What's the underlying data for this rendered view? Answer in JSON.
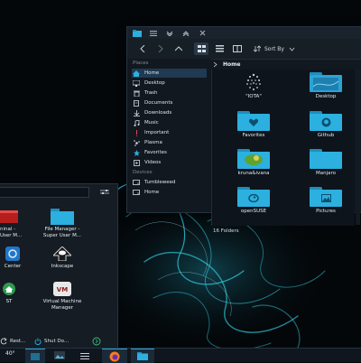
{
  "file_manager": {
    "sort_label": "Sort By",
    "breadcrumb": "Home",
    "sidebar": {
      "places_title": "Places",
      "devices_title": "Devices",
      "places": [
        {
          "label": "Home",
          "icon": "home-icon"
        },
        {
          "label": "Desktop",
          "icon": "desktop-icon"
        },
        {
          "label": "Trash",
          "icon": "trash-icon"
        },
        {
          "label": "Documents",
          "icon": "documents-icon"
        },
        {
          "label": "Downloads",
          "icon": "downloads-icon"
        },
        {
          "label": "Music",
          "icon": "music-icon"
        },
        {
          "label": "Important",
          "icon": "important-icon"
        },
        {
          "label": "Plasma",
          "icon": "plasma-icon"
        },
        {
          "label": "Favorites",
          "icon": "favorites-icon"
        },
        {
          "label": "Videos",
          "icon": "videos-icon"
        }
      ],
      "devices": [
        {
          "label": "Tumbleweed",
          "icon": "drive-icon"
        },
        {
          "label": "Home",
          "icon": "drive-icon"
        }
      ]
    },
    "files": [
      {
        "label": "\"IOTA\"",
        "icon": "iota-logo-icon"
      },
      {
        "label": "Desktop",
        "icon": "folder-desktop-icon"
      },
      {
        "label": "Favorites",
        "icon": "folder-favorites-icon"
      },
      {
        "label": "Github",
        "icon": "folder-github-icon"
      },
      {
        "label": "kruna&ivana",
        "icon": "folder-image-icon"
      },
      {
        "label": "Manjaro",
        "icon": "folder-icon"
      },
      {
        "label": "openSUSE",
        "icon": "folder-opensuse-icon"
      },
      {
        "label": "Pictures",
        "icon": "folder-pictures-icon"
      }
    ],
    "status": "16 Folders"
  },
  "launcher": {
    "apps": [
      {
        "line1": "ninal -",
        "line2": "User M...",
        "icon": "terminal-icon"
      },
      {
        "line1": "File Manager -",
        "line2": "Super User M...",
        "icon": "file-manager-folder-icon"
      },
      {
        "line1": "Center",
        "line2": "",
        "icon": "control-center-icon"
      },
      {
        "line1": "Inkscape",
        "line2": "",
        "icon": "inkscape-icon"
      },
      {
        "line1": "ST",
        "line2": "",
        "icon": "home-app-icon"
      },
      {
        "line1": "Virtual Machine",
        "line2": "Manager",
        "icon": "virtual-machine-icon"
      }
    ],
    "footer": {
      "restart": "Rest...",
      "shutdown": "Shut Do..."
    }
  },
  "taskbar": {
    "temperature": "40°"
  },
  "colors": {
    "accent": "#2bb0e0",
    "selection": "#1f3a52",
    "window_bg": "#121820"
  }
}
